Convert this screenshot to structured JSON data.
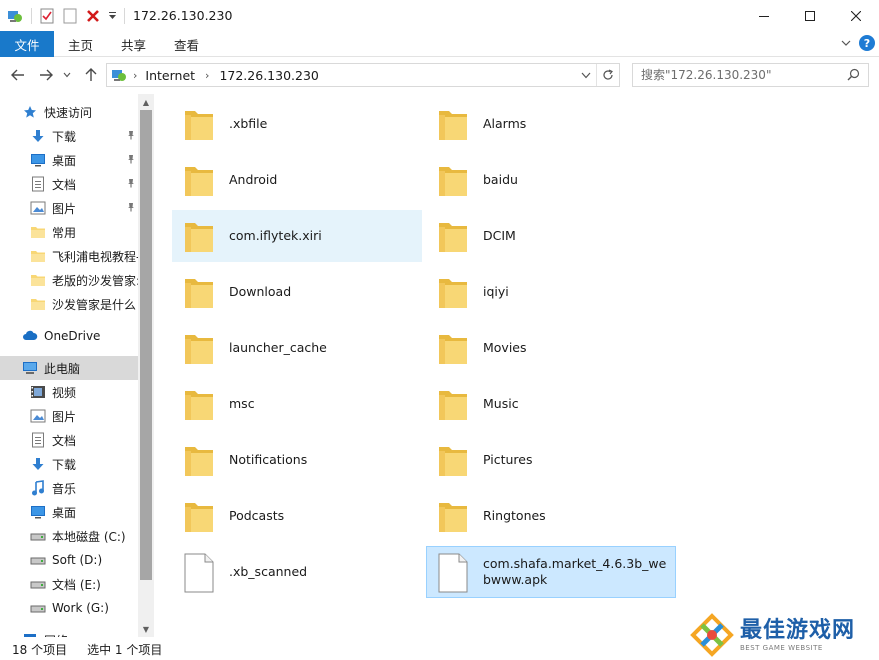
{
  "window": {
    "title": "172.26.130.230"
  },
  "ribbon": {
    "tabs": [
      "文件",
      "主页",
      "共享",
      "查看"
    ]
  },
  "address": {
    "crumbs": [
      "Internet",
      "172.26.130.230"
    ]
  },
  "search": {
    "placeholder": "搜索\"172.26.130.230\""
  },
  "nav": {
    "items": [
      {
        "label": "快速访问",
        "icon": "star-icon"
      },
      {
        "label": "下载",
        "icon": "download-arrow-icon",
        "pinned": true
      },
      {
        "label": "桌面",
        "icon": "desktop-icon",
        "pinned": true
      },
      {
        "label": "文档",
        "icon": "document-icon",
        "pinned": true
      },
      {
        "label": "图片",
        "icon": "picture-icon",
        "pinned": true
      },
      {
        "label": "常用",
        "icon": "folder-icon"
      },
      {
        "label": "飞利浦电视教程-",
        "icon": "folder-icon"
      },
      {
        "label": "老版的沙发管家:",
        "icon": "folder-icon"
      },
      {
        "label": "沙发管家是什么",
        "icon": "folder-icon"
      },
      {
        "label": "OneDrive",
        "icon": "cloud-icon"
      },
      {
        "label": "此电脑",
        "icon": "computer-icon",
        "selected": true
      },
      {
        "label": "视频",
        "icon": "video-icon"
      },
      {
        "label": "图片",
        "icon": "picture-icon"
      },
      {
        "label": "文档",
        "icon": "document-icon"
      },
      {
        "label": "下载",
        "icon": "download-arrow-icon"
      },
      {
        "label": "音乐",
        "icon": "music-icon"
      },
      {
        "label": "桌面",
        "icon": "desktop-icon"
      },
      {
        "label": "本地磁盘 (C:)",
        "icon": "drive-icon"
      },
      {
        "label": "Soft (D:)",
        "icon": "drive-icon"
      },
      {
        "label": "文档 (E:)",
        "icon": "drive-icon"
      },
      {
        "label": "Work (G:)",
        "icon": "drive-icon"
      },
      {
        "label": "网络",
        "icon": "network-icon"
      }
    ]
  },
  "files": [
    {
      "name": ".xbfile",
      "type": "folder"
    },
    {
      "name": "Alarms",
      "type": "folder"
    },
    {
      "name": "Android",
      "type": "folder"
    },
    {
      "name": "baidu",
      "type": "folder"
    },
    {
      "name": "com.iflytek.xiri",
      "type": "folder",
      "state": "hover"
    },
    {
      "name": "DCIM",
      "type": "folder"
    },
    {
      "name": "Download",
      "type": "folder"
    },
    {
      "name": "iqiyi",
      "type": "folder"
    },
    {
      "name": "launcher_cache",
      "type": "folder"
    },
    {
      "name": "Movies",
      "type": "folder"
    },
    {
      "name": "msc",
      "type": "folder"
    },
    {
      "name": "Music",
      "type": "folder"
    },
    {
      "name": "Notifications",
      "type": "folder"
    },
    {
      "name": "Pictures",
      "type": "folder"
    },
    {
      "name": "Podcasts",
      "type": "folder"
    },
    {
      "name": "Ringtones",
      "type": "folder"
    },
    {
      "name": ".xb_scanned",
      "type": "file"
    },
    {
      "name": "com.shafa.market_4.6.3b_webwww.apk",
      "type": "file",
      "state": "selected"
    }
  ],
  "status": {
    "count": "18 个项目",
    "selection": "选中 1 个项目"
  },
  "watermark": {
    "cn": "最佳游戏网",
    "en": "BEST GAME WEBSITE"
  },
  "colors": {
    "accent": "#1979ca",
    "folder": "#f8d775",
    "selection": "#cce8ff",
    "hover": "#e5f3fb"
  }
}
